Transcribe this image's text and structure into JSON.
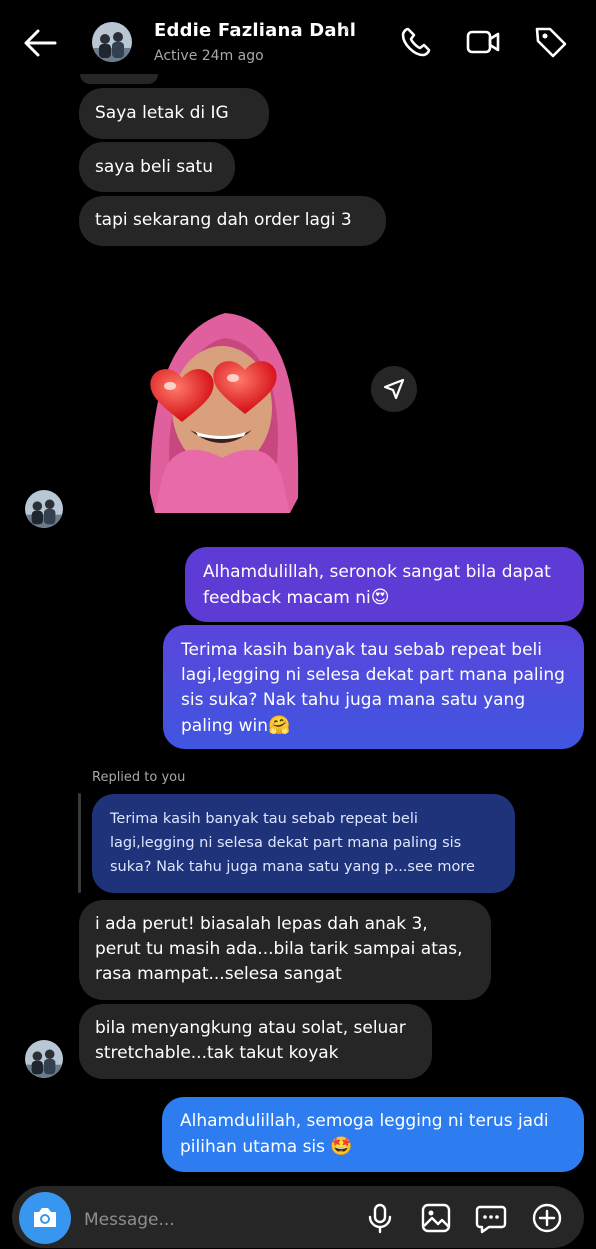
{
  "header": {
    "contact_name": "Eddie Fazliana Dahl",
    "chevron": "›",
    "status": "Active 24m ago",
    "icons": [
      "back-arrow-icon",
      "phone-icon",
      "video-camera-icon",
      "tag-icon"
    ]
  },
  "messages": {
    "in_1": "Saya letak di IG",
    "in_2": "saya beli satu",
    "in_3": "tapi sekarang dah order lagi 3",
    "sticker": "memoji-heart-eyes-sticker",
    "out_1": "Alhamdulillah, seronok sangat bila dapat feedback macam ni",
    "out_1_emoji": "😍",
    "out_2": "Terima kasih banyak tau sebab repeat beli lagi,legging ni selesa dekat part mana paling sis suka? Nak tahu juga mana satu yang paling win",
    "out_2_emoji": "🤗",
    "reply_label": "Replied to you",
    "quoted": "Terima kasih banyak tau sebab repeat beli lagi,legging ni selesa dekat part mana paling sis suka? Nak tahu juga mana satu yang p...see more",
    "in_4": "i ada perut! biasalah lepas dah anak 3, perut tu masih ada...bila tarik sampai atas, rasa mampat...selesa sangat",
    "in_5": "bila menyangkung atau solat, seluar stretchable...tak takut koyak",
    "out_3": "Alhamdulillah, semoga legging ni terus jadi pilihan utama sis",
    "out_3_emoji": "🤩"
  },
  "composer": {
    "placeholder": "Message..."
  },
  "colors": {
    "incoming": "#262626",
    "outgoing_purple": "#5f3bd6",
    "outgoing_blue": "#2d7df0",
    "camera_button": "#3797f0",
    "quoted_reply": "#1e3379"
  }
}
